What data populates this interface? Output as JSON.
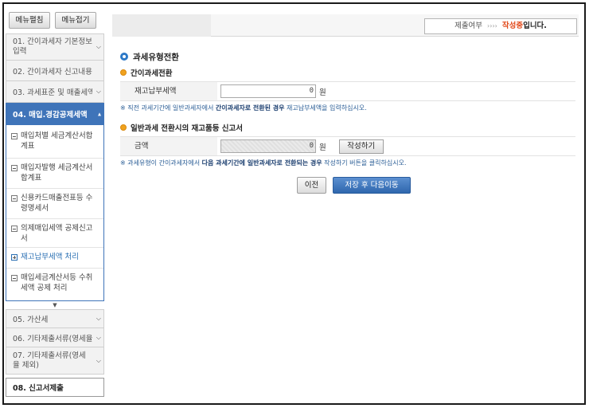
{
  "sidebar": {
    "expand_label": "메뉴펼침",
    "collapse_label": "메뉴접기",
    "steps_top": [
      {
        "label": "01. 간이과세자 기본정보 입력"
      },
      {
        "label": "02. 간이과세자 신고내용"
      },
      {
        "label": "03. 과세표준 및 매출세액"
      }
    ],
    "active_step": {
      "label": "04. 매입.경감공제세액"
    },
    "subitems": [
      {
        "label": "매입처별 세금계산서합계표"
      },
      {
        "label": "매입자발행 세금계산서합계표"
      },
      {
        "label": "신용카드매출전표등 수령명세서"
      },
      {
        "label": "의제매입세액 공제신고서"
      },
      {
        "label": "재고납부세액 처리"
      },
      {
        "label": "매입세금계산서등 수취세액 공제 처리"
      }
    ],
    "steps_bottom": [
      {
        "label": "05. 가산세"
      },
      {
        "label": "06. 기타제출서류(영세율)"
      },
      {
        "label": "07. 기타제출서류(영세율 제외)"
      },
      {
        "label": "08. 신고서제출"
      }
    ]
  },
  "status": {
    "label": "제출여부",
    "arrows": "››››",
    "value": "작성중",
    "suffix": "입니다."
  },
  "main": {
    "title": "과세유형전환",
    "section1": {
      "heading": "간이과세전환",
      "field_label": "재고납부세액",
      "field_value": "0",
      "unit": "원",
      "note_pre": "※ 직전 과세기간에 일반과세자에서 ",
      "note_bold": "간이과세자로 전환된 경우",
      "note_post": " 재고납부세액을 입력하십시오."
    },
    "section2": {
      "heading": "일반과세 전환시의 재고품등 신고서",
      "field_label": "금액",
      "field_value": "0",
      "unit": "원",
      "button_label": "작성하기",
      "note_pre": "※ 과세유형이 간이과세자에서 ",
      "note_bold": "다음 과세기간에 일반과세자로 전환되는 경우",
      "note_post": " 작성하기 버튼을 클릭하십시오."
    },
    "prev_label": "이전",
    "next_label": "저장 후 다음이동"
  }
}
